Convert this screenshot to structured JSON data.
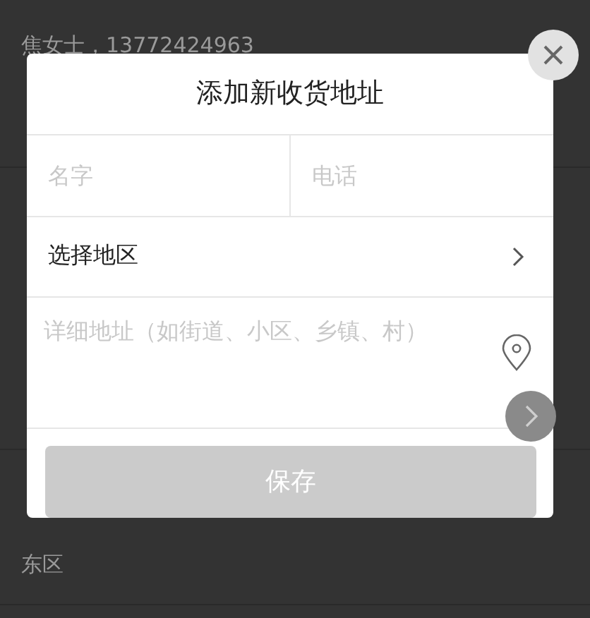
{
  "background": {
    "contact": "焦女士，13772424963",
    "district": "东区"
  },
  "dialog": {
    "title": "添加新收货地址",
    "name_field": {
      "placeholder": "名字"
    },
    "phone_field": {
      "placeholder": "电话"
    },
    "region": {
      "label": "选择地区"
    },
    "detail_field": {
      "placeholder": "详细地址（如街道、小区、乡镇、村）"
    },
    "save_button": {
      "label": "保存",
      "disabled": true
    }
  }
}
